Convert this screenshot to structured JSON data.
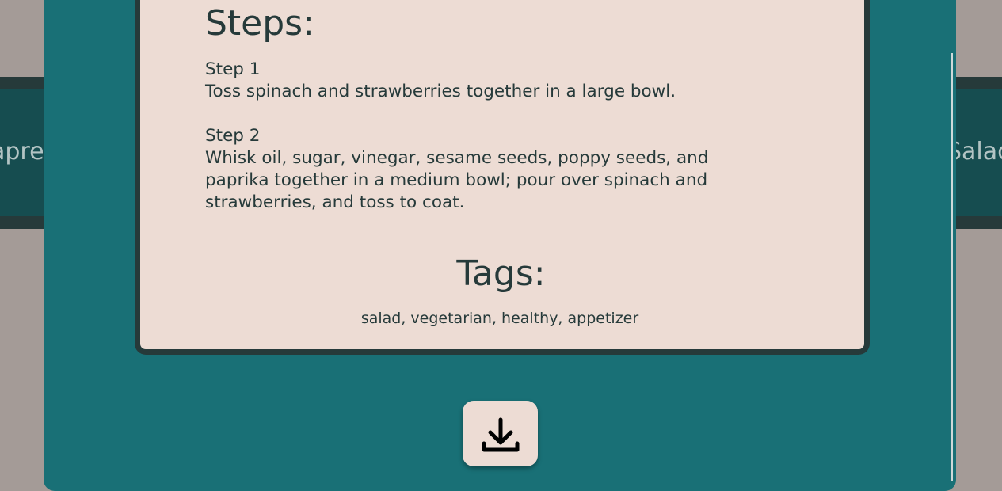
{
  "background": {
    "left_title_fragment": "apre",
    "right_title_fragment": "Salad"
  },
  "recipe": {
    "steps_heading": "Steps:",
    "steps": [
      {
        "label": "Step 1",
        "text": "Toss spinach and strawberries together in a large bowl."
      },
      {
        "label": "Step 2",
        "text": "Whisk oil, sugar, vinegar, sesame seeds, poppy seeds, and paprika together in a medium bowl; pour over spinach and strawberries, and toss to coat."
      }
    ],
    "tags_heading": "Tags:",
    "tags": "salad, vegetarian, healthy, appetizer"
  },
  "actions": {
    "download_icon": "download-icon"
  },
  "colors": {
    "page_background": "#a49b97",
    "modal_teal": "#197076",
    "card_background": "#eddcd4",
    "card_border": "#263a3a",
    "text": "#263a3a"
  }
}
